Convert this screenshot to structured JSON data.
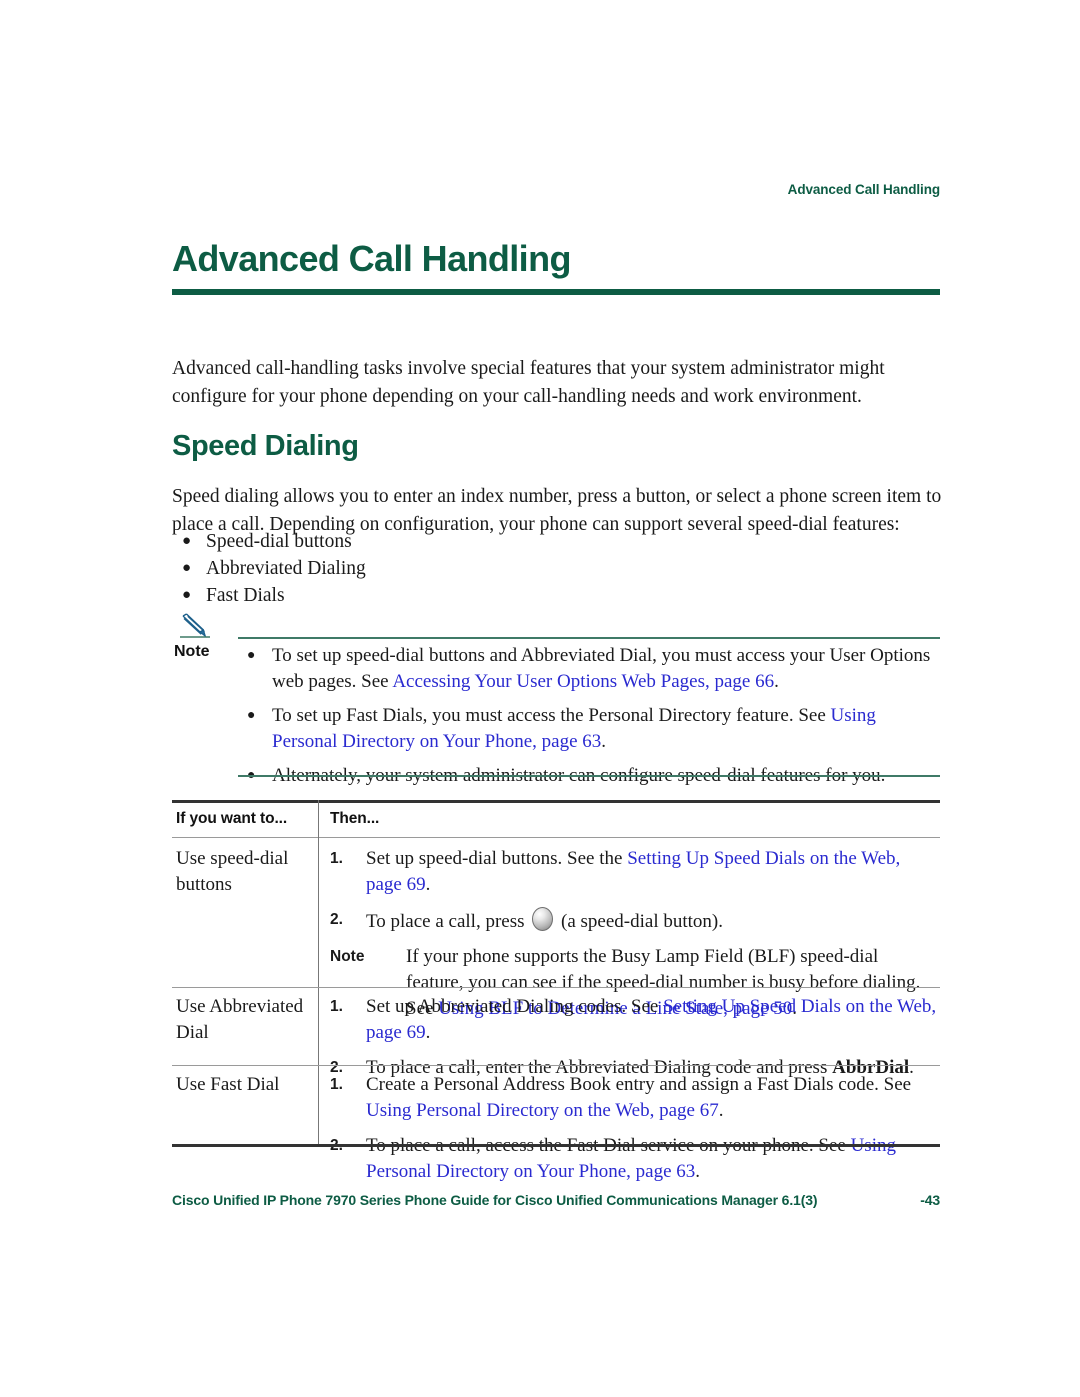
{
  "colors": {
    "heading_green": "#0d5c44",
    "link_blue": "#2a2ad0",
    "rule_green": "#3f7a67",
    "body_text": "#1a1a1a"
  },
  "running_header": "Advanced Call Handling",
  "chapter": {
    "title": "Advanced Call Handling",
    "intro": "Advanced call-handling tasks involve special features that your system administrator might configure for your phone depending on your call-handling needs and work environment."
  },
  "section": {
    "heading": "Speed Dialing",
    "paragraph": "Speed dialing allows you to enter an index number, press a button, or select a phone screen item to place a call. Depending on configuration, your phone can support several speed-dial features:",
    "bullets": [
      "Speed-dial buttons",
      "Abbreviated Dialing",
      "Fast Dials"
    ]
  },
  "note_block": {
    "icon": "pencil-icon",
    "label": "Note",
    "bullet_char": "•",
    "items": [
      {
        "pre": "To set up speed-dial buttons and Abbreviated Dial, you must access your User Options web pages. See ",
        "link": "Accessing Your User Options Web Pages, page 66",
        "post": "."
      },
      {
        "pre": "To set up Fast Dials, you must access the Personal Directory feature. See ",
        "link": "Using Personal Directory on Your Phone, page 63",
        "post": "."
      },
      {
        "pre": "Alternately, your system administrator can configure speed-dial features for you.",
        "link": "",
        "post": ""
      }
    ]
  },
  "table": {
    "headers": [
      "If you want to...",
      "Then..."
    ],
    "rows": [
      {
        "task": "Use speed-dial buttons",
        "steps": [
          {
            "marker": "1.",
            "type": "step",
            "pre": "Set up speed-dial buttons. See the ",
            "link": "Setting Up Speed Dials on the Web, page 69",
            "post": "."
          },
          {
            "marker": "2.",
            "type": "step-with-icon",
            "pre": "To place a call, press ",
            "icon": "speed-dial-button-icon",
            "post": " (a speed-dial button)."
          },
          {
            "marker": "Note",
            "type": "note",
            "pre": "If your phone supports the Busy Lamp Field (BLF) speed-dial feature, you can see if the speed-dial number is busy before dialing. See ",
            "link": "Using BLF to Determine a Line State, page 50",
            "post": "."
          }
        ]
      },
      {
        "task": "Use Abbreviated Dial",
        "steps": [
          {
            "marker": "1.",
            "type": "step",
            "pre": "Set up Abbreviated Dialing codes. See ",
            "link": "Setting Up Speed Dials on the Web, page 69",
            "post": "."
          },
          {
            "marker": "2.",
            "type": "step-with-bold",
            "pre": "To place a call, enter the Abbreviated Dialing code and press ",
            "bold": "AbbrDial",
            "post": "."
          }
        ]
      },
      {
        "task": "Use Fast Dial",
        "steps": [
          {
            "marker": "1.",
            "type": "step",
            "pre": "Create a Personal Address Book entry and assign a Fast Dials code. See ",
            "link": "Using Personal Directory on the Web, page 67",
            "post": "."
          },
          {
            "marker": "2.",
            "type": "step",
            "pre": "To place a call, access the Fast Dial service on your phone. See ",
            "link": "Using Personal Directory on Your Phone, page 63",
            "post": "."
          }
        ]
      }
    ]
  },
  "footer": {
    "text": "Cisco Unified IP Phone 7970 Series Phone Guide for Cisco Unified Communications Manager 6.1(3)",
    "page": "-43"
  }
}
